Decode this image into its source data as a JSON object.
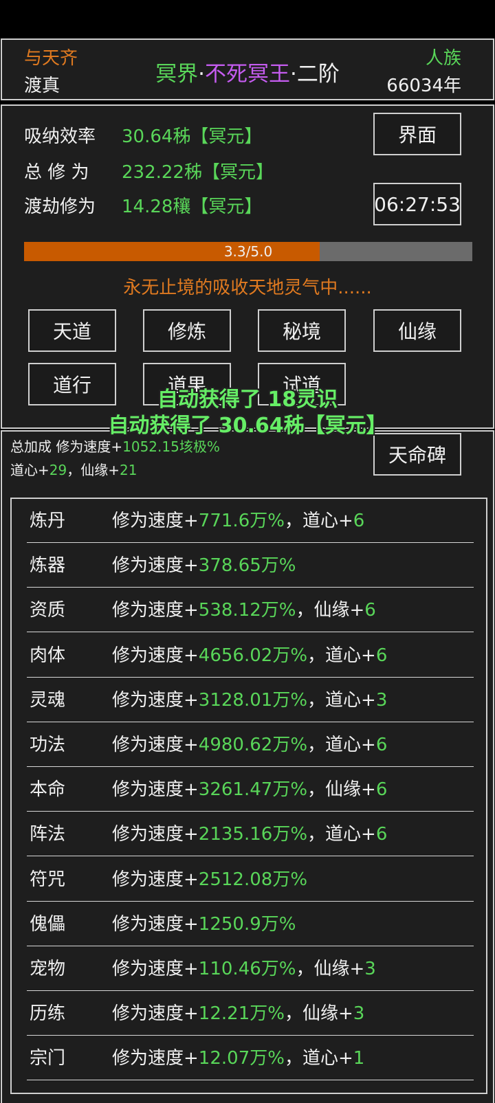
{
  "header": {
    "left_title": "与天齐",
    "left_sub": "渡真",
    "realm_part1": "冥界",
    "dot": "·",
    "realm_part2": "不死冥王",
    "realm_part3": "二阶",
    "race": "人族",
    "years": "66034年"
  },
  "stats": {
    "absorb_label": "吸纳效率",
    "absorb_value": "30.64秭【冥元】",
    "total_label": "总 修 为",
    "total_value": "232.22秭【冥元】",
    "tribulation_label": "渡劫修为",
    "tribulation_value": "14.28穰【冥元】"
  },
  "buttons": {
    "interface": "界面",
    "timer": "06:27:53",
    "tiandao": "天道",
    "xiulian": "修炼",
    "mijing": "秘境",
    "xianyuan": "仙缘",
    "daoxing": "道行",
    "daoguo": "道果",
    "shidao": "试道",
    "tianmingbei": "天命碑"
  },
  "progress": {
    "text": "3.3/5.0",
    "value": 3.3,
    "max": 5.0
  },
  "status_text": "永无止境的吸收天地灵气中......",
  "toasts": [
    "自动获得了 18灵识",
    "自动获得了 30.64秭【冥元】"
  ],
  "bonus": {
    "prefix": "总加成 修为速度+",
    "speed": "1052.15垓极%",
    "daoxin_label": "道心+",
    "daoxin": "29",
    "sep": "，仙缘+",
    "xianyuan": "21"
  },
  "rows": [
    {
      "name": "炼丹",
      "label": "修为速度+",
      "value": "771.6万%",
      "extra_label": "，道心+",
      "extra_value": "6"
    },
    {
      "name": "炼器",
      "label": "修为速度+",
      "value": "378.65万%",
      "extra_label": "",
      "extra_value": ""
    },
    {
      "name": "资质",
      "label": "修为速度+",
      "value": "538.12万%",
      "extra_label": "，仙缘+",
      "extra_value": "6"
    },
    {
      "name": "肉体",
      "label": "修为速度+",
      "value": "4656.02万%",
      "extra_label": "，道心+",
      "extra_value": "6"
    },
    {
      "name": "灵魂",
      "label": "修为速度+",
      "value": "3128.01万%",
      "extra_label": "，道心+",
      "extra_value": "3"
    },
    {
      "name": "功法",
      "label": "修为速度+",
      "value": "4980.62万%",
      "extra_label": "，道心+",
      "extra_value": "6"
    },
    {
      "name": "本命",
      "label": "修为速度+",
      "value": "3261.47万%",
      "extra_label": "，仙缘+",
      "extra_value": "6"
    },
    {
      "name": "阵法",
      "label": "修为速度+",
      "value": "2135.16万%",
      "extra_label": "，道心+",
      "extra_value": "6"
    },
    {
      "name": "符咒",
      "label": "修为速度+",
      "value": "2512.08万%",
      "extra_label": "",
      "extra_value": ""
    },
    {
      "name": "傀儡",
      "label": "修为速度+",
      "value": "1250.9万%",
      "extra_label": "",
      "extra_value": ""
    },
    {
      "name": "宠物",
      "label": "修为速度+",
      "value": "110.46万%",
      "extra_label": "，仙缘+",
      "extra_value": "3"
    },
    {
      "name": "历练",
      "label": "修为速度+",
      "value": "12.21万%",
      "extra_label": "，仙缘+",
      "extra_value": "3"
    },
    {
      "name": "宗门",
      "label": "修为速度+",
      "value": "12.07万%",
      "extra_label": "，道心+",
      "extra_value": "1"
    }
  ]
}
